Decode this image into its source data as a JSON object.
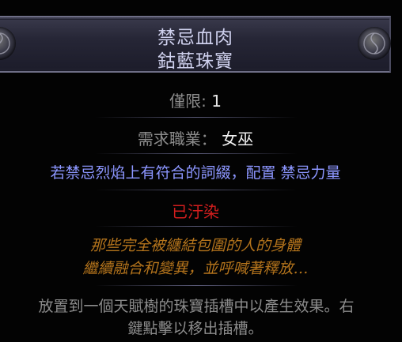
{
  "item": {
    "name": "禁忌血肉",
    "base_type": "鈷藍珠寶"
  },
  "properties": {
    "limit_label": "僅限: ",
    "limit_value": "1"
  },
  "requirements": {
    "class_label": "需求職業： ",
    "class_value": "女巫"
  },
  "explicit_mod": "若禁忌烈焰上有符合的詞綴，配置 禁忌力量",
  "corrupted_text": "已汙染",
  "flavor_text": [
    "那些完全被纏結包圍的人的身體",
    "繼續融合和變異，並呼喊著釋放…"
  ],
  "help_text": [
    "放置到一個天賦樹的珠寶插槽中以產生效果。右",
    "鍵點擊以移出插槽。"
  ],
  "colors": {
    "title": "#cfd1ee",
    "label": "#8c8c8c",
    "value": "#e8e8e8",
    "magic_mod": "#8c96ff",
    "corrupted": "#d21e1e",
    "flavor": "#b4741c",
    "frame": "#6e6e86"
  },
  "icons": [
    "header-ornament-left-icon",
    "header-ornament-right-icon"
  ]
}
